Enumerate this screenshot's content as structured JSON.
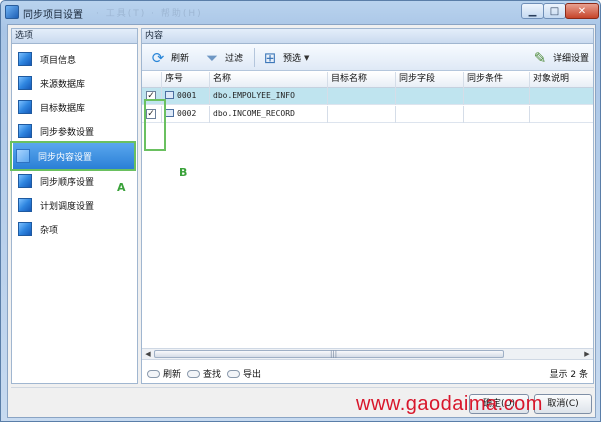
{
  "window": {
    "title": "同步项目设置",
    "ghost_menu": "·  工具(T)   ·   帮助(H)"
  },
  "left_panel": {
    "header": "选项",
    "items": [
      {
        "label": "项目信息"
      },
      {
        "label": "来源数据库"
      },
      {
        "label": "目标数据库"
      },
      {
        "label": "同步参数设置"
      },
      {
        "label": "同步内容设置",
        "selected": true
      },
      {
        "label": "同步顺序设置"
      },
      {
        "label": "计划调度设置"
      },
      {
        "label": "杂项"
      }
    ],
    "annotation": "A"
  },
  "right_panel": {
    "header": "内容",
    "toolbar": {
      "refresh": "刷新",
      "filter": "过滤",
      "preview": "预选",
      "detail": "详细设置"
    },
    "grid": {
      "columns": [
        "序号",
        "名称",
        "目标名称",
        "同步字段",
        "同步条件",
        "对象说明"
      ],
      "rows": [
        {
          "checked": true,
          "seq": "0001",
          "name": "dbo.EMPOLYEE_INFO",
          "target": "",
          "fields": "",
          "condition": "",
          "desc": "",
          "highlight": true
        },
        {
          "checked": true,
          "seq": "0002",
          "name": "dbo.INCOME_RECORD",
          "target": "",
          "fields": "",
          "condition": "",
          "desc": "",
          "highlight": false
        }
      ]
    },
    "annotation": "B",
    "status": {
      "refresh": "刷新",
      "find": "查找",
      "export": "导出",
      "count": "显示 2 条"
    }
  },
  "footer": {
    "ok": "确定(O)",
    "cancel": "取消(C)"
  },
  "watermark": "www.gaodaima.com"
}
